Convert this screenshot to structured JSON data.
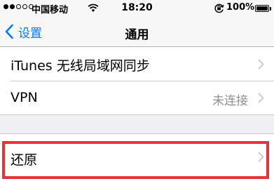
{
  "status_bar": {
    "signal_dots": [
      true,
      true,
      false,
      false,
      false
    ],
    "carrier": "中国移动",
    "wifi_icon": "wifi-icon",
    "time": "18:20",
    "rotation_lock_icon": "rotation-lock-icon",
    "battery_percent": "100%",
    "battery_icon": "battery-icon",
    "battery_level": 1.0
  },
  "nav_bar": {
    "back_icon": "chevron-left-icon",
    "back_label": "设置",
    "title": "通用"
  },
  "group_1": {
    "rows": [
      {
        "label": "iTunes 无线局域网同步",
        "value": "",
        "icon": "chevron-right-icon"
      },
      {
        "label": "VPN",
        "value": "未连接",
        "icon": "chevron-right-icon"
      }
    ]
  },
  "group_2": {
    "rows": [
      {
        "label": "还原",
        "value": "",
        "icon": "chevron-right-icon"
      }
    ]
  },
  "colors": {
    "accent": "#007aff",
    "highlight": "#e8323a",
    "background": "#efeff4",
    "secondary_text": "#8e8e93",
    "disclosure": "#c7c7cc"
  }
}
